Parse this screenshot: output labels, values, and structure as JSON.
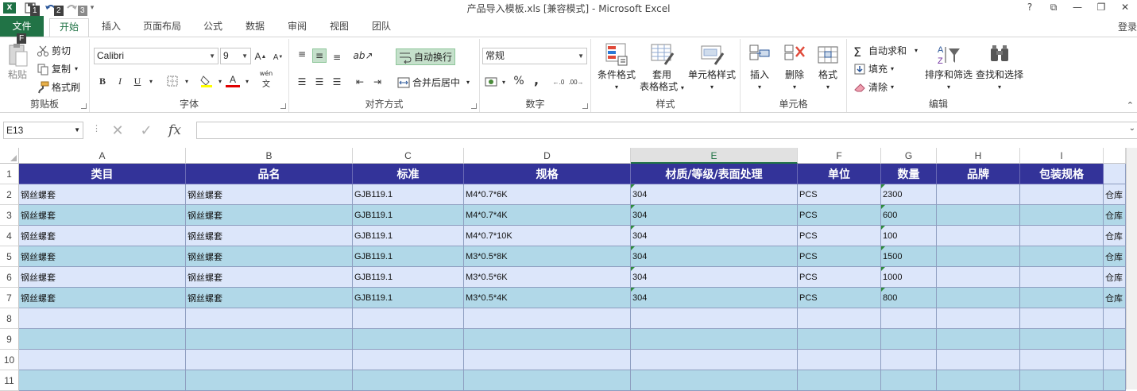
{
  "window": {
    "title": "产品导入模板.xls  [兼容模式] - Microsoft Excel",
    "controls": [
      "?",
      "⧉",
      "—",
      "❐",
      "✕"
    ],
    "keytips": [
      "1",
      "2",
      "3",
      "F"
    ]
  },
  "tabs": {
    "file": "文件",
    "items": [
      "开始",
      "插入",
      "页面布局",
      "公式",
      "数据",
      "审阅",
      "视图",
      "团队"
    ],
    "active": "开始",
    "signin": "登录"
  },
  "ribbon": {
    "clipboard": {
      "label": "剪贴板",
      "paste": "粘贴",
      "cut": "剪切",
      "copy": "复制",
      "format_painter": "格式刷"
    },
    "font": {
      "label": "字体",
      "name": "Calibri",
      "size": "9",
      "grow": "A",
      "shrink": "A",
      "bold": "B",
      "italic": "I",
      "underline": "U",
      "phonetic": "wén"
    },
    "alignment": {
      "label": "对齐方式",
      "wrap_text": "自动换行",
      "merge_center": "合并后居中"
    },
    "number": {
      "label": "数字",
      "format": "常规",
      "percent": "%",
      "comma": ","
    },
    "styles": {
      "label": "样式",
      "conditional": "条件格式",
      "format_table_1": "套用",
      "format_table_2": "表格格式",
      "cell_styles": "单元格样式"
    },
    "cells": {
      "label": "单元格",
      "insert": "插入",
      "delete": "删除",
      "format": "格式"
    },
    "editing": {
      "label": "编辑",
      "autosum": "自动求和",
      "fill": "填充",
      "clear": "清除",
      "sort_filter": "排序和筛选",
      "find_select": "查找和选择"
    }
  },
  "formula_bar": {
    "name_box": "E13",
    "formula": "",
    "fx": "fx"
  },
  "sheet": {
    "selected_column": "E",
    "columns": [
      "A",
      "B",
      "C",
      "D",
      "E",
      "F",
      "G",
      "H",
      "I"
    ],
    "row_numbers": [
      "1",
      "2",
      "3",
      "4",
      "5",
      "6",
      "7",
      "8",
      "9",
      "10",
      "11"
    ],
    "header_row": [
      "类目",
      "品名",
      "标准",
      "规格",
      "材质/等级/表面处理",
      "单位",
      "数量",
      "品牌",
      "包装规格"
    ],
    "rows": [
      [
        "钢丝螺套",
        "钢丝螺套",
        "GJB119.1",
        "M4*0.7*6K",
        "304",
        "PCS",
        "2300",
        "",
        "",
        "仓库"
      ],
      [
        "钢丝螺套",
        "钢丝螺套",
        "GJB119.1",
        "M4*0.7*4K",
        "304",
        "PCS",
        "600",
        "",
        "",
        "仓库"
      ],
      [
        "钢丝螺套",
        "钢丝螺套",
        "GJB119.1",
        "M4*0.7*10K",
        "304",
        "PCS",
        "100",
        "",
        "",
        "仓库"
      ],
      [
        "钢丝螺套",
        "钢丝螺套",
        "GJB119.1",
        "M3*0.5*8K",
        "304",
        "PCS",
        "1500",
        "",
        "",
        "仓库"
      ],
      [
        "钢丝螺套",
        "钢丝螺套",
        "GJB119.1",
        "M3*0.5*6K",
        "304",
        "PCS",
        "1000",
        "",
        "",
        "仓库"
      ],
      [
        "钢丝螺套",
        "钢丝螺套",
        "GJB119.1",
        "M3*0.5*4K",
        "304",
        "PCS",
        "800",
        "",
        "",
        "仓库"
      ],
      [
        "",
        "",
        "",
        "",
        "",
        "",
        "",
        "",
        "",
        ""
      ],
      [
        "",
        "",
        "",
        "",
        "",
        "",
        "",
        "",
        "",
        ""
      ],
      [
        "",
        "",
        "",
        "",
        "",
        "",
        "",
        "",
        "",
        ""
      ],
      [
        "",
        "",
        "",
        "",
        "",
        "",
        "",
        "",
        "",
        ""
      ]
    ]
  },
  "colors": {
    "accent": "#217346",
    "header_fill": "#333399",
    "band_a": "#dce6fa",
    "band_b": "#b1d8e8",
    "error_triangle": "#2e8b3d"
  }
}
